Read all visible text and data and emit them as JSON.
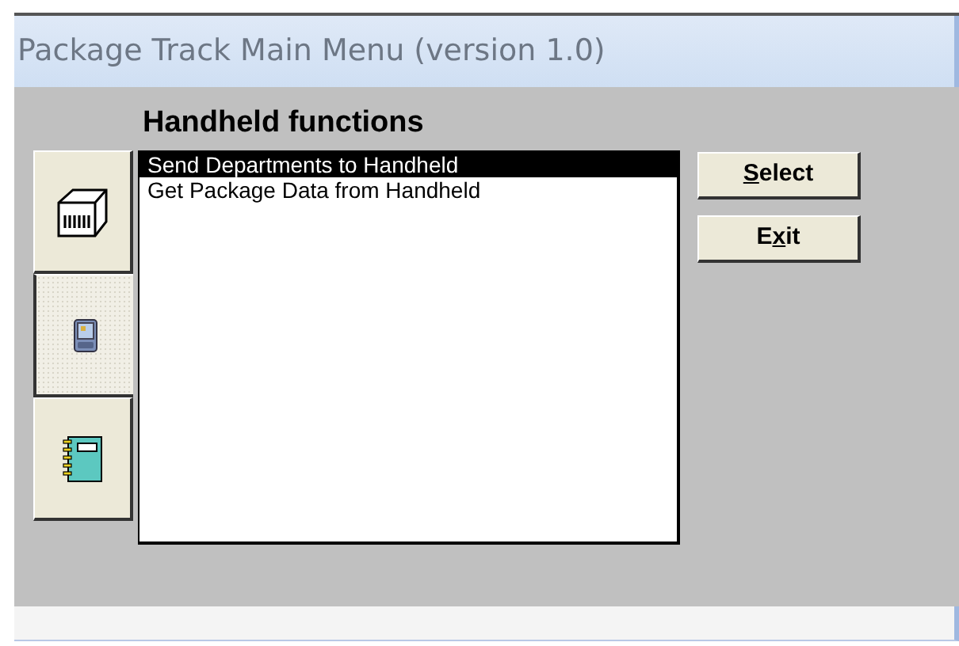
{
  "window": {
    "title": "Package Track Main Menu (version 1.0)"
  },
  "heading": "Handheld functions",
  "side_tabs": [
    {
      "kind": "package",
      "selected": false
    },
    {
      "kind": "handheld",
      "selected": true
    },
    {
      "kind": "notebook",
      "selected": false
    }
  ],
  "list": [
    {
      "label": "Send Departments to Handheld",
      "selected": true
    },
    {
      "label": "Get Package Data from Handheld",
      "selected": false
    }
  ],
  "buttons": [
    {
      "access_key": "S",
      "label_rest": "elect"
    },
    {
      "label_start": "E",
      "access_key": "x",
      "label_rest": "it"
    }
  ]
}
